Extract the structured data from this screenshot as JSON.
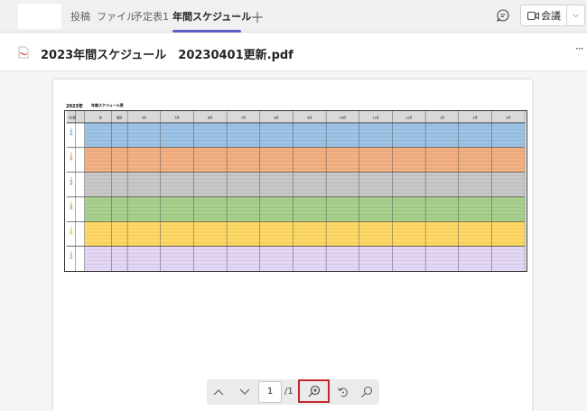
{
  "tabs": [
    {
      "label": "投稿"
    },
    {
      "label": "ファイル"
    },
    {
      "label": "予定表1"
    },
    {
      "label": "年間スケジュール",
      "active": true
    }
  ],
  "header_actions": {
    "meet_label": "会議"
  },
  "file": {
    "title": "2023年間スケジュール　20230401更新.pdf"
  },
  "document": {
    "year_label": "2023年",
    "subtitle": "年間スケジュール表",
    "header_cells": [
      "月/週",
      "年",
      "項目",
      "4月",
      "5月",
      "6月",
      "7月",
      "8月",
      "9月",
      "10月",
      "11月",
      "12月",
      "1月",
      "2月",
      "3月"
    ],
    "bands": [
      {
        "label": "１学期",
        "color": "#9dc3e6",
        "label_color": "#3c78c8"
      },
      {
        "label": "２学期",
        "color": "#f4b183",
        "label_color": "#d06020"
      },
      {
        "label": "３学期",
        "color": "#c9c9c9",
        "label_color": "#707070"
      },
      {
        "label": "４学期",
        "color": "#a9d18e",
        "label_color": "#4f9a35"
      },
      {
        "label": "５学期",
        "color": "#ffd966",
        "label_color": "#c9a000"
      },
      {
        "label": "６学期",
        "color": "#e4d6f5",
        "label_color": "#8a6fb5"
      }
    ]
  },
  "pager": {
    "current_page": "1",
    "total": "/1"
  },
  "colors": {
    "accent": "#5b5fc7",
    "highlight": "#c4262e"
  }
}
